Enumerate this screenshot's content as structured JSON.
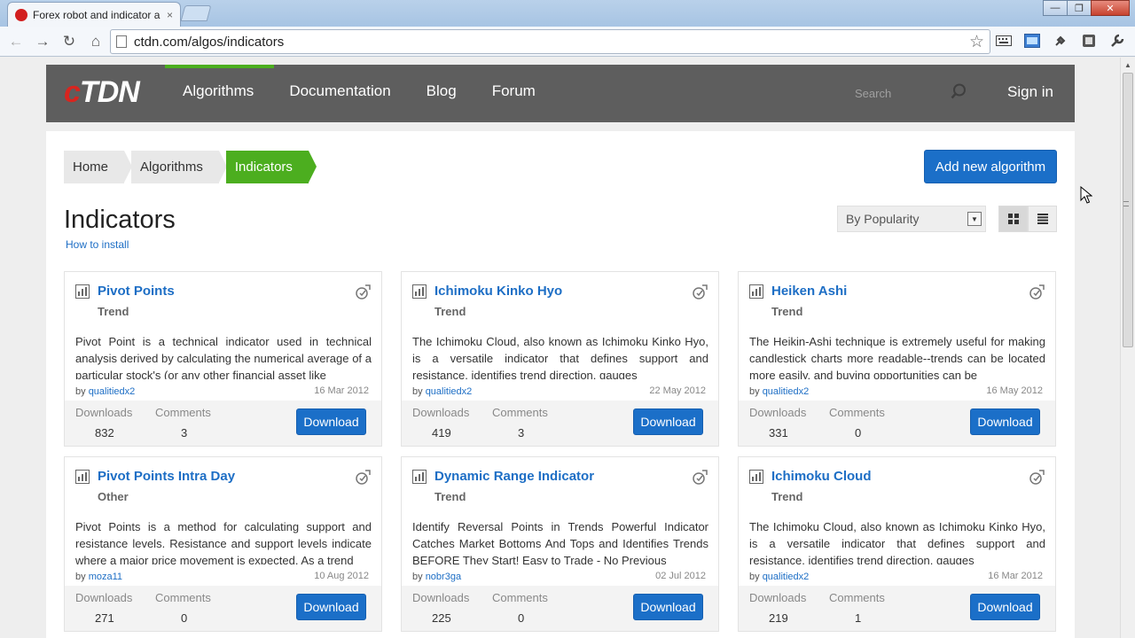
{
  "browser": {
    "tab_title": "Forex robot and indicator a",
    "tab_close": "×",
    "url": "ctdn.com/algos/indicators",
    "win_min": "—",
    "win_max": "❐",
    "win_close": "✕"
  },
  "site": {
    "logo_c": "c",
    "logo_rest": "TDN",
    "nav": [
      "Algorithms",
      "Documentation",
      "Blog",
      "Forum"
    ],
    "search_placeholder": "Search",
    "signin": "Sign in"
  },
  "breadcrumb": [
    "Home",
    "Algorithms",
    "Indicators"
  ],
  "add_button": "Add new algorithm",
  "page_title": "Indicators",
  "how_to_install": "How to install",
  "sort_value": "By Popularity",
  "labels": {
    "by": "by",
    "downloads": "Downloads",
    "comments": "Comments",
    "download_btn": "Download"
  },
  "cards": [
    {
      "title": "Pivot Points",
      "category": "Trend",
      "description": "Pivot Point is a technical indicator used in technical analysis derived by calculating the numerical average of a particular stock's (or any other financial asset like",
      "author": "qualitiedx2",
      "date": "16 Mar 2012",
      "downloads": "832",
      "comments": "3"
    },
    {
      "title": "Ichimoku Kinko Hyo",
      "category": "Trend",
      "description": "The Ichimoku Cloud, also known as Ichimoku Kinko Hyo, is a versatile indicator that defines support and resistance, identifies trend direction, gauges",
      "author": "qualitiedx2",
      "date": "22 May 2012",
      "downloads": "419",
      "comments": "3"
    },
    {
      "title": "Heiken Ashi",
      "category": "Trend",
      "description": "The Heikin-Ashi technique is extremely useful for making candlestick charts more readable--trends can be located more easily, and buying opportunities can be",
      "author": "qualitiedx2",
      "date": "16 May 2012",
      "downloads": "331",
      "comments": "0"
    },
    {
      "title": "Pivot Points Intra Day",
      "category": "Other",
      "description": "Pivot Points is a method for calculating support and resistance levels. Resistance and support levels indicate where a major price movement is expected. As a trend",
      "author": "moza11",
      "date": "10 Aug 2012",
      "downloads": "271",
      "comments": "0"
    },
    {
      "title": "Dynamic Range Indicator",
      "category": "Trend",
      "description": "Identify Reversal Points in Trends Powerful Indicator Catches Market Bottoms And Tops and Identifies Trends BEFORE They Start! Easy to Trade - No Previous",
      "author": "nobr3ga",
      "date": "02 Jul 2012",
      "downloads": "225",
      "comments": "0"
    },
    {
      "title": "Ichimoku Cloud",
      "category": "Trend",
      "description": "The Ichimoku Cloud, also known as Ichimoku Kinko Hyo, is a versatile indicator that defines support and resistance, identifies trend direction, gauges",
      "author": "qualitiedx2",
      "date": "16 Mar 2012",
      "downloads": "219",
      "comments": "1"
    }
  ],
  "colors": {
    "accent_green": "#4cae1f",
    "link_blue": "#1d6ec5",
    "button_blue": "#1b6fc8",
    "header_gray": "#5e5e5e",
    "logo_red": "#d8251f"
  }
}
